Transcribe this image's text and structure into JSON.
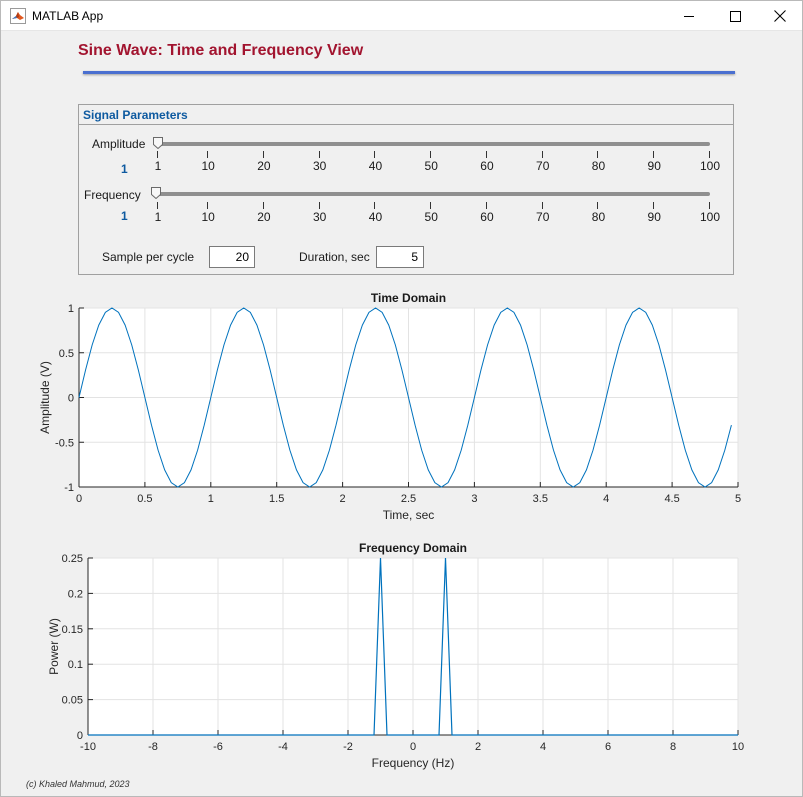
{
  "window": {
    "title": "MATLAB App"
  },
  "app": {
    "title": "Sine Wave: Time and Frequency View"
  },
  "panel": {
    "title": "Signal Parameters",
    "amplitude": {
      "label": "Amplitude",
      "value": "1",
      "min": 1,
      "max": 100,
      "tick_labels": [
        "1",
        "10",
        "20",
        "30",
        "40",
        "50",
        "60",
        "70",
        "80",
        "90",
        "100"
      ]
    },
    "frequency": {
      "label": "Frequency",
      "value": "1",
      "min": 1,
      "max": 100,
      "tick_labels": [
        "1",
        "10",
        "20",
        "30",
        "40",
        "50",
        "60",
        "70",
        "80",
        "90",
        "100"
      ]
    },
    "samples": {
      "label": "Sample per cycle",
      "value": "20"
    },
    "duration": {
      "label": "Duration, sec",
      "value": "5"
    }
  },
  "footer": {
    "credit": "(c) Khaled Mahmud, 2023"
  },
  "colors": {
    "title": "#a2142f",
    "accent": "#0e5aa0",
    "line": "#0072bd",
    "rule": "#4a6fd0"
  },
  "chart_data": [
    {
      "type": "line",
      "title": "Time Domain",
      "xlabel": "Time, sec",
      "ylabel": "Amplitude (V)",
      "xlim": [
        0,
        5
      ],
      "ylim": [
        -1,
        1
      ],
      "xticks": [
        "0",
        "0.5",
        "1",
        "1.5",
        "2",
        "2.5",
        "3",
        "3.5",
        "4",
        "4.5",
        "5"
      ],
      "yticks": [
        "-1",
        "-0.5",
        "0",
        "0.5",
        "1"
      ],
      "grid": true,
      "series": [
        {
          "function": "sin(2*pi*1*t)",
          "amplitude": 1,
          "frequency_hz": 1,
          "x_start": 0,
          "x_end": 4.95,
          "x_step": 0.05
        }
      ]
    },
    {
      "type": "line",
      "title": "Frequency Domain",
      "xlabel": "Frequency (Hz)",
      "ylabel": "Power (W)",
      "xlim": [
        -10,
        10
      ],
      "ylim": [
        0,
        0.25
      ],
      "xticks": [
        "-10",
        "-8",
        "-6",
        "-4",
        "-2",
        "0",
        "2",
        "4",
        "6",
        "8",
        "10"
      ],
      "yticks": [
        "0",
        "0.05",
        "0.1",
        "0.15",
        "0.2",
        "0.25"
      ],
      "grid": true,
      "series": [
        {
          "x": [
            -10,
            -1.2,
            -1,
            -0.8,
            0.8,
            1,
            1.2,
            10
          ],
          "y": [
            0,
            0,
            0.25,
            0,
            0,
            0.25,
            0,
            0
          ]
        }
      ]
    }
  ]
}
